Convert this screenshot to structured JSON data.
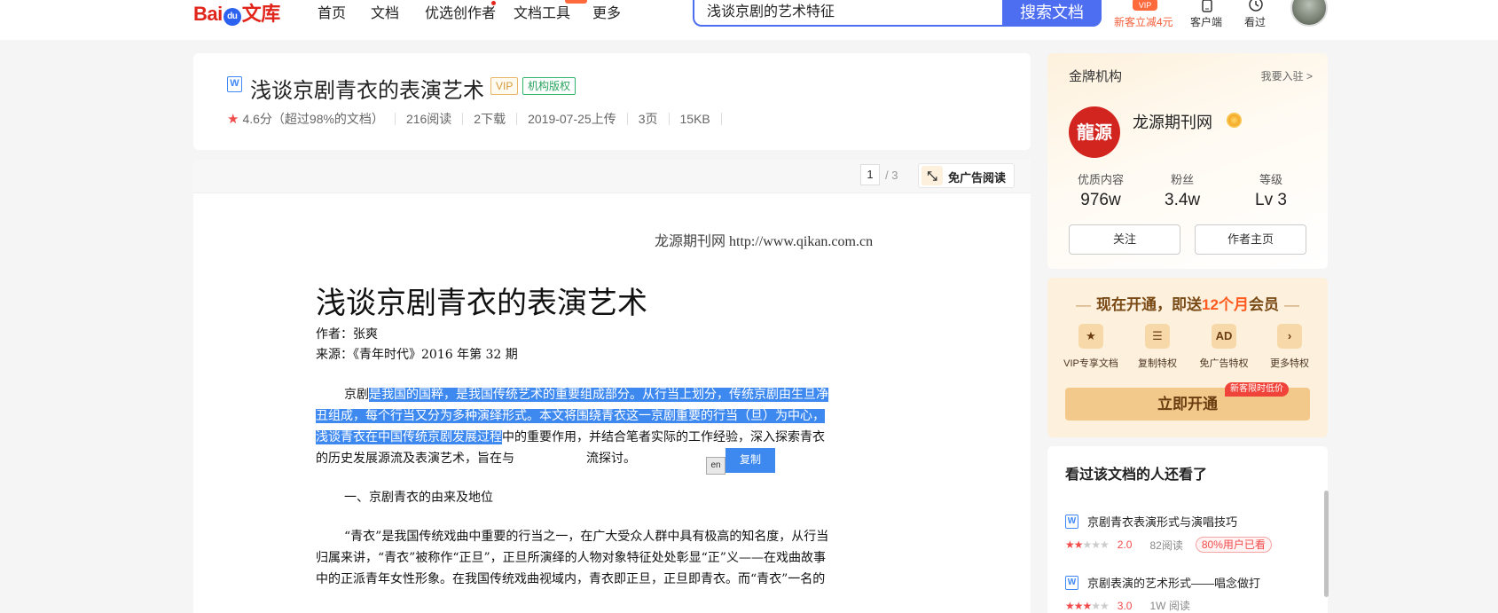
{
  "brand": {
    "bai": "Bai",
    "du": "du",
    "wenku": "文库"
  },
  "nav": {
    "items": [
      {
        "label": "首页"
      },
      {
        "label": "文档"
      },
      {
        "label": "优选创作者"
      },
      {
        "label": "文档工具"
      },
      {
        "label": "更多"
      }
    ]
  },
  "search": {
    "value": "浅谈京剧的艺术特征",
    "button": "搜索文档"
  },
  "top_actions": {
    "vip": "新客立减4元",
    "client": "客户端",
    "history": "看过"
  },
  "doc": {
    "title": "浅谈京剧青衣的表演艺术",
    "tag_vip": "VIP",
    "tag_org": "机构版权",
    "rating": "4.6分（超过98%的文档）",
    "reads": "216阅读",
    "downloads": "2下载",
    "uploaded": "2019-07-25上传",
    "pages": "3页",
    "size": "15KB"
  },
  "viewer": {
    "page_current": "1",
    "page_total": "/ 3",
    "no_ad": "免广告阅读"
  },
  "paper": {
    "source_cn": "龙源期刊网",
    "source_url": "http://www.qikan.com.cn",
    "title": "浅谈京剧青衣的表演艺术",
    "author": "作者：张爽",
    "from": "来源：《青年时代》2016 年第 32 期",
    "p1_a": "京剧",
    "p1_sel1": "是我国的国粹，是我国传统艺术的重要组成部分。从行当上划分，传统京剧由生旦净",
    "p1_sel2": "丑组成，每个行当又分为多种演绎形式。本文将围绕青衣这一京剧重要的行当（旦）为中心，",
    "p1_sel3": "浅谈青衣在中国传统京剧发展过程",
    "p1_b": "中的重要作用，并结合笔者实际的工作经验，深入探索青衣",
    "p1_c": "的历史发展源流及表演艺术，旨在与",
    "p1_d": "流探讨。",
    "copy": "复制",
    "h1": "一、京剧青衣的由来及地位",
    "p2_l1": "“青衣”是我国传统戏曲中重要的行当之一，在广大受众人群中具有极高的知名度，从行当",
    "p2_l2": "归属来讲，“青衣”被称作“正旦”，正旦所演绎的人物对象特征处处彰显“正”义——在戏曲故事",
    "p2_l3": "中的正派青年女性形象。在我国传统戏曲视域内，青衣即正旦，正旦即青衣。而“青衣”一名的"
  },
  "org_card": {
    "heading": "金牌机构",
    "join": "我要入驻 >",
    "logo_text": "龍源",
    "name": "龙源期刊网",
    "stats": [
      {
        "label": "优质内容",
        "value": "976w"
      },
      {
        "label": "粉丝",
        "value": "3.4w"
      },
      {
        "label": "等级",
        "value": "Lv 3"
      }
    ],
    "follow": "关注",
    "home": "作者主页"
  },
  "vip_card": {
    "dash": "—",
    "text_a": "现在开通，即送",
    "text_hl": "12个月",
    "text_b": "会员",
    "features": [
      {
        "icon": "★",
        "label": "VIP专享文档"
      },
      {
        "icon": "☰",
        "label": "复制特权"
      },
      {
        "icon": "AD",
        "label": "免广告特权"
      },
      {
        "icon": "›",
        "label": "更多特权"
      }
    ],
    "button": "立即开通",
    "badge": "新客限时低价"
  },
  "rec_card": {
    "heading": "看过该文档的人还看了",
    "items": [
      {
        "title": "京剧青衣表演形式与演唱技巧",
        "score": "2.0",
        "reads": "82阅读",
        "tag": "80%用户已看",
        "stars_on": "★★",
        "stars_off": "★★★"
      },
      {
        "title": "京剧表演的艺术形式——唱念做打",
        "score": "3.0",
        "reads": "1W 阅读",
        "tag": "",
        "stars_on": "★★★",
        "stars_off": "★★"
      }
    ]
  },
  "colors": {
    "accent": "#4e6ef2",
    "brand_red": "#e1251b",
    "selection": "#3e89f0",
    "vip_gold": "#f3c98b"
  }
}
